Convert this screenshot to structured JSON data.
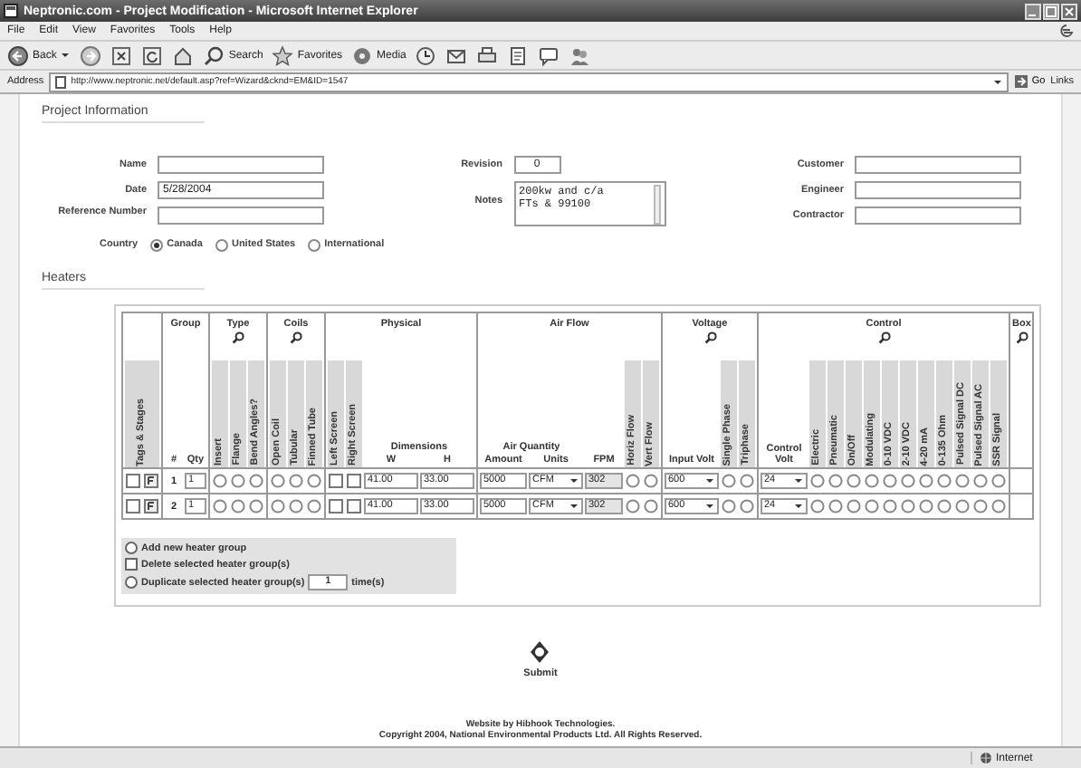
{
  "window": {
    "title": "Neptronic.com - Project Modification - Microsoft Internet Explorer"
  },
  "menu": [
    "File",
    "Edit",
    "View",
    "Favorites",
    "Tools",
    "Help"
  ],
  "toolbar": [
    {
      "kind": "back",
      "label": "Back"
    },
    {
      "kind": "forward"
    },
    {
      "kind": "stop"
    },
    {
      "kind": "refresh"
    },
    {
      "kind": "home"
    },
    {
      "kind": "search",
      "label": "Search"
    },
    {
      "kind": "favorites",
      "label": "Favorites"
    },
    {
      "kind": "media",
      "label": "Media"
    },
    {
      "kind": "history"
    },
    {
      "kind": "mail"
    },
    {
      "kind": "print"
    },
    {
      "kind": "edit"
    },
    {
      "kind": "discuss"
    },
    {
      "kind": "messenger"
    }
  ],
  "address": {
    "label": "Address",
    "url": "http://www.neptronic.net/default.asp?ref=Wizard&cknd=EM&ID=1547",
    "go": "Go",
    "links": "Links"
  },
  "project": {
    "title": "Project Information",
    "columns": [
      [
        {
          "kind": "text",
          "label": "Name"
        },
        {
          "kind": "text",
          "label": "Date",
          "value": "5/28/2004"
        },
        {
          "kind": "text",
          "label": "Reference Number"
        }
      ],
      [
        {
          "kind": "short",
          "label": "Revision",
          "value": "0"
        },
        {
          "kind": "textarea",
          "label": "Notes",
          "value": "200kw and c/a\nFTs & 99100"
        }
      ],
      [
        {
          "kind": "text",
          "label": "Customer"
        },
        {
          "kind": "text",
          "label": "Engineer"
        },
        {
          "kind": "text",
          "label": "Contractor"
        }
      ]
    ],
    "country": {
      "label": "Country",
      "options": [
        {
          "label": "Canada",
          "selected": true
        },
        {
          "label": "United States",
          "selected": false
        },
        {
          "label": "International",
          "selected": false
        }
      ]
    }
  },
  "heaters": {
    "title": "Heaters",
    "groups": [
      {
        "subs": [
          {
            "kind": "vertical",
            "label": "Tags & Stages"
          }
        ]
      },
      {
        "label": "Group",
        "search": false,
        "subs": [
          {
            "kind": "bottom",
            "label": "#"
          },
          {
            "kind": "bottom",
            "label": "Qty"
          }
        ]
      },
      {
        "label": "Type",
        "search": true,
        "subs": [
          {
            "kind": "vertical",
            "label": "Insert"
          },
          {
            "kind": "vertical",
            "label": "Flange"
          },
          {
            "kind": "vertical",
            "label": "Bend Angles?"
          }
        ]
      },
      {
        "label": "Coils",
        "search": true,
        "subs": [
          {
            "kind": "vertical",
            "label": "Open Coil"
          },
          {
            "kind": "vertical",
            "label": "Tubular"
          },
          {
            "kind": "vertical",
            "label": "Finned Tube"
          }
        ]
      },
      {
        "label": "Physical",
        "search": false,
        "subs": [
          {
            "kind": "vertical",
            "label": "Left Screen"
          },
          {
            "kind": "vertical",
            "label": "Right Screen"
          },
          {
            "kind": "stacked",
            "title": "Dimensions",
            "parts": [
              "W",
              "H"
            ]
          }
        ]
      },
      {
        "label": "Air Flow",
        "search": false,
        "subs": [
          {
            "kind": "stacked",
            "title": "Air Quantity",
            "parts": [
              "Amount",
              "Units"
            ]
          },
          {
            "kind": "bottom",
            "label": "FPM"
          },
          {
            "kind": "vertical",
            "label": "Horiz Flow"
          },
          {
            "kind": "vertical",
            "label": "Vert Flow"
          }
        ]
      },
      {
        "label": "Voltage",
        "search": true,
        "subs": [
          {
            "kind": "bottom",
            "label": "Input Volt"
          },
          {
            "kind": "vertical",
            "label": "Single Phase"
          },
          {
            "kind": "vertical",
            "label": "Triphase"
          }
        ]
      },
      {
        "label": "Control",
        "search": true,
        "subs": [
          {
            "kind": "bottom",
            "label": "Control Volt"
          },
          {
            "kind": "vertical",
            "label": "Electric"
          },
          {
            "kind": "vertical",
            "label": "Pneumatic"
          },
          {
            "kind": "vertical",
            "label": "On/Off"
          },
          {
            "kind": "vertical",
            "label": "Modulating"
          },
          {
            "kind": "vertical",
            "label": "0-10 VDC"
          },
          {
            "kind": "vertical",
            "label": "2-10 VDC"
          },
          {
            "kind": "vertical",
            "label": "4-20 mA"
          },
          {
            "kind": "vertical",
            "label": "0-135 Ohm"
          },
          {
            "kind": "vertical",
            "label": "Pulsed Signal DC"
          },
          {
            "kind": "vertical",
            "label": "Pulsed Signal AC"
          },
          {
            "kind": "vertical",
            "label": "SSR Signal"
          }
        ]
      },
      {
        "label": "Box",
        "search": true
      }
    ],
    "rows": [
      {
        "groups": [
          [
            {
              "kind": "checkbox",
              "checked": false
            },
            {
              "kind": "tag"
            }
          ],
          [
            {
              "kind": "label",
              "value": "1"
            },
            {
              "kind": "text",
              "value": "1"
            }
          ],
          [
            {
              "kind": "radio",
              "selected": false
            },
            {
              "kind": "radio",
              "selected": false
            },
            {
              "kind": "radio",
              "selected": false
            }
          ],
          [
            {
              "kind": "radio",
              "selected": false
            },
            {
              "kind": "radio",
              "selected": false
            },
            {
              "kind": "radio",
              "selected": false
            }
          ],
          [
            {
              "kind": "checkbox",
              "checked": false
            },
            {
              "kind": "checkbox",
              "checked": false
            },
            {
              "kind": "text",
              "value": "41.00"
            },
            {
              "kind": "text",
              "value": "33.00"
            }
          ],
          [
            {
              "kind": "text",
              "value": "5000"
            },
            {
              "kind": "select",
              "value": "CFM"
            },
            {
              "kind": "readonly",
              "value": "302"
            },
            {
              "kind": "radio",
              "selected": false
            },
            {
              "kind": "radio",
              "selected": false
            }
          ],
          [
            {
              "kind": "select",
              "value": "600"
            },
            {
              "kind": "radio",
              "selected": false
            },
            {
              "kind": "radio",
              "selected": false
            }
          ],
          [
            {
              "kind": "select",
              "value": "24"
            },
            {
              "kind": "radio",
              "selected": false
            },
            {
              "kind": "radio",
              "selected": false
            },
            {
              "kind": "radio",
              "selected": false
            },
            {
              "kind": "radio",
              "selected": false
            },
            {
              "kind": "radio",
              "selected": false
            },
            {
              "kind": "radio",
              "selected": false
            },
            {
              "kind": "radio",
              "selected": false
            },
            {
              "kind": "radio",
              "selected": false
            },
            {
              "kind": "radio",
              "selected": false
            },
            {
              "kind": "radio",
              "selected": false
            },
            {
              "kind": "radio",
              "selected": false
            }
          ]
        ]
      },
      {
        "groups": [
          [
            {
              "kind": "checkbox",
              "checked": false
            },
            {
              "kind": "tag"
            }
          ],
          [
            {
              "kind": "label",
              "value": "2"
            },
            {
              "kind": "text",
              "value": "1"
            }
          ],
          [
            {
              "kind": "radio",
              "selected": false
            },
            {
              "kind": "radio",
              "selected": false
            },
            {
              "kind": "radio",
              "selected": false
            }
          ],
          [
            {
              "kind": "radio",
              "selected": false
            },
            {
              "kind": "radio",
              "selected": false
            },
            {
              "kind": "radio",
              "selected": false
            }
          ],
          [
            {
              "kind": "checkbox",
              "checked": false
            },
            {
              "kind": "checkbox",
              "checked": false
            },
            {
              "kind": "text",
              "value": "41.00"
            },
            {
              "kind": "text",
              "value": "33.00"
            }
          ],
          [
            {
              "kind": "text",
              "value": "5000"
            },
            {
              "kind": "select",
              "value": "CFM"
            },
            {
              "kind": "readonly",
              "value": "302"
            },
            {
              "kind": "radio",
              "selected": false
            },
            {
              "kind": "radio",
              "selected": false
            }
          ],
          [
            {
              "kind": "select",
              "value": "600"
            },
            {
              "kind": "radio",
              "selected": false
            },
            {
              "kind": "radio",
              "selected": false
            }
          ],
          [
            {
              "kind": "select",
              "value": "24"
            },
            {
              "kind": "radio",
              "selected": false
            },
            {
              "kind": "radio",
              "selected": false
            },
            {
              "kind": "radio",
              "selected": false
            },
            {
              "kind": "radio",
              "selected": false
            },
            {
              "kind": "radio",
              "selected": false
            },
            {
              "kind": "radio",
              "selected": false
            },
            {
              "kind": "radio",
              "selected": false
            },
            {
              "kind": "radio",
              "selected": false
            },
            {
              "kind": "radio",
              "selected": false
            },
            {
              "kind": "radio",
              "selected": false
            },
            {
              "kind": "radio",
              "selected": false
            }
          ]
        ]
      }
    ],
    "actions": [
      {
        "kind": "radio",
        "label": "Add new heater group",
        "selected": false
      },
      {
        "kind": "checkbox",
        "label": "Delete selected heater group(s)",
        "checked": false
      },
      {
        "kind": "radio",
        "label": "Duplicate selected heater group(s)",
        "selected": false,
        "value": "1",
        "suffix": "time(s)"
      }
    ]
  },
  "submit": {
    "label": "Submit"
  },
  "footer": [
    "Website by Hibhook Technologies.",
    "Copyright 2004, National Environmental Products Ltd. All Rights Reserved."
  ],
  "status_bar": {
    "zone": "Internet"
  }
}
